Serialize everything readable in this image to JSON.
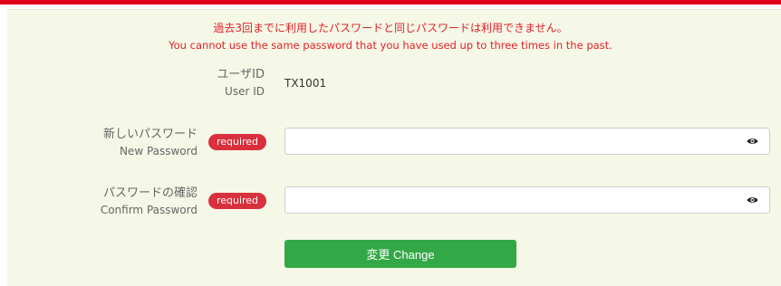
{
  "error": {
    "jp": "過去3回までに利用したパスワードと同じパスワードは利用できません。",
    "en": "You cannot use the same password that you have used up to three times in the past."
  },
  "user_id": {
    "label_jp": "ユーザID",
    "label_en": "User ID",
    "value": "TX1001"
  },
  "new_password": {
    "label_jp": "新しいパスワード",
    "label_en": "New Password",
    "badge": "required",
    "value": ""
  },
  "confirm_password": {
    "label_jp": "パスワードの確認",
    "label_en": "Confirm Password",
    "badge": "required",
    "value": ""
  },
  "submit": {
    "label": "変更 Change"
  },
  "colors": {
    "accent_red": "#e3202a",
    "badge_red": "#d9303d",
    "button_green": "#33a847",
    "panel_bg": "#f5f8e6"
  }
}
